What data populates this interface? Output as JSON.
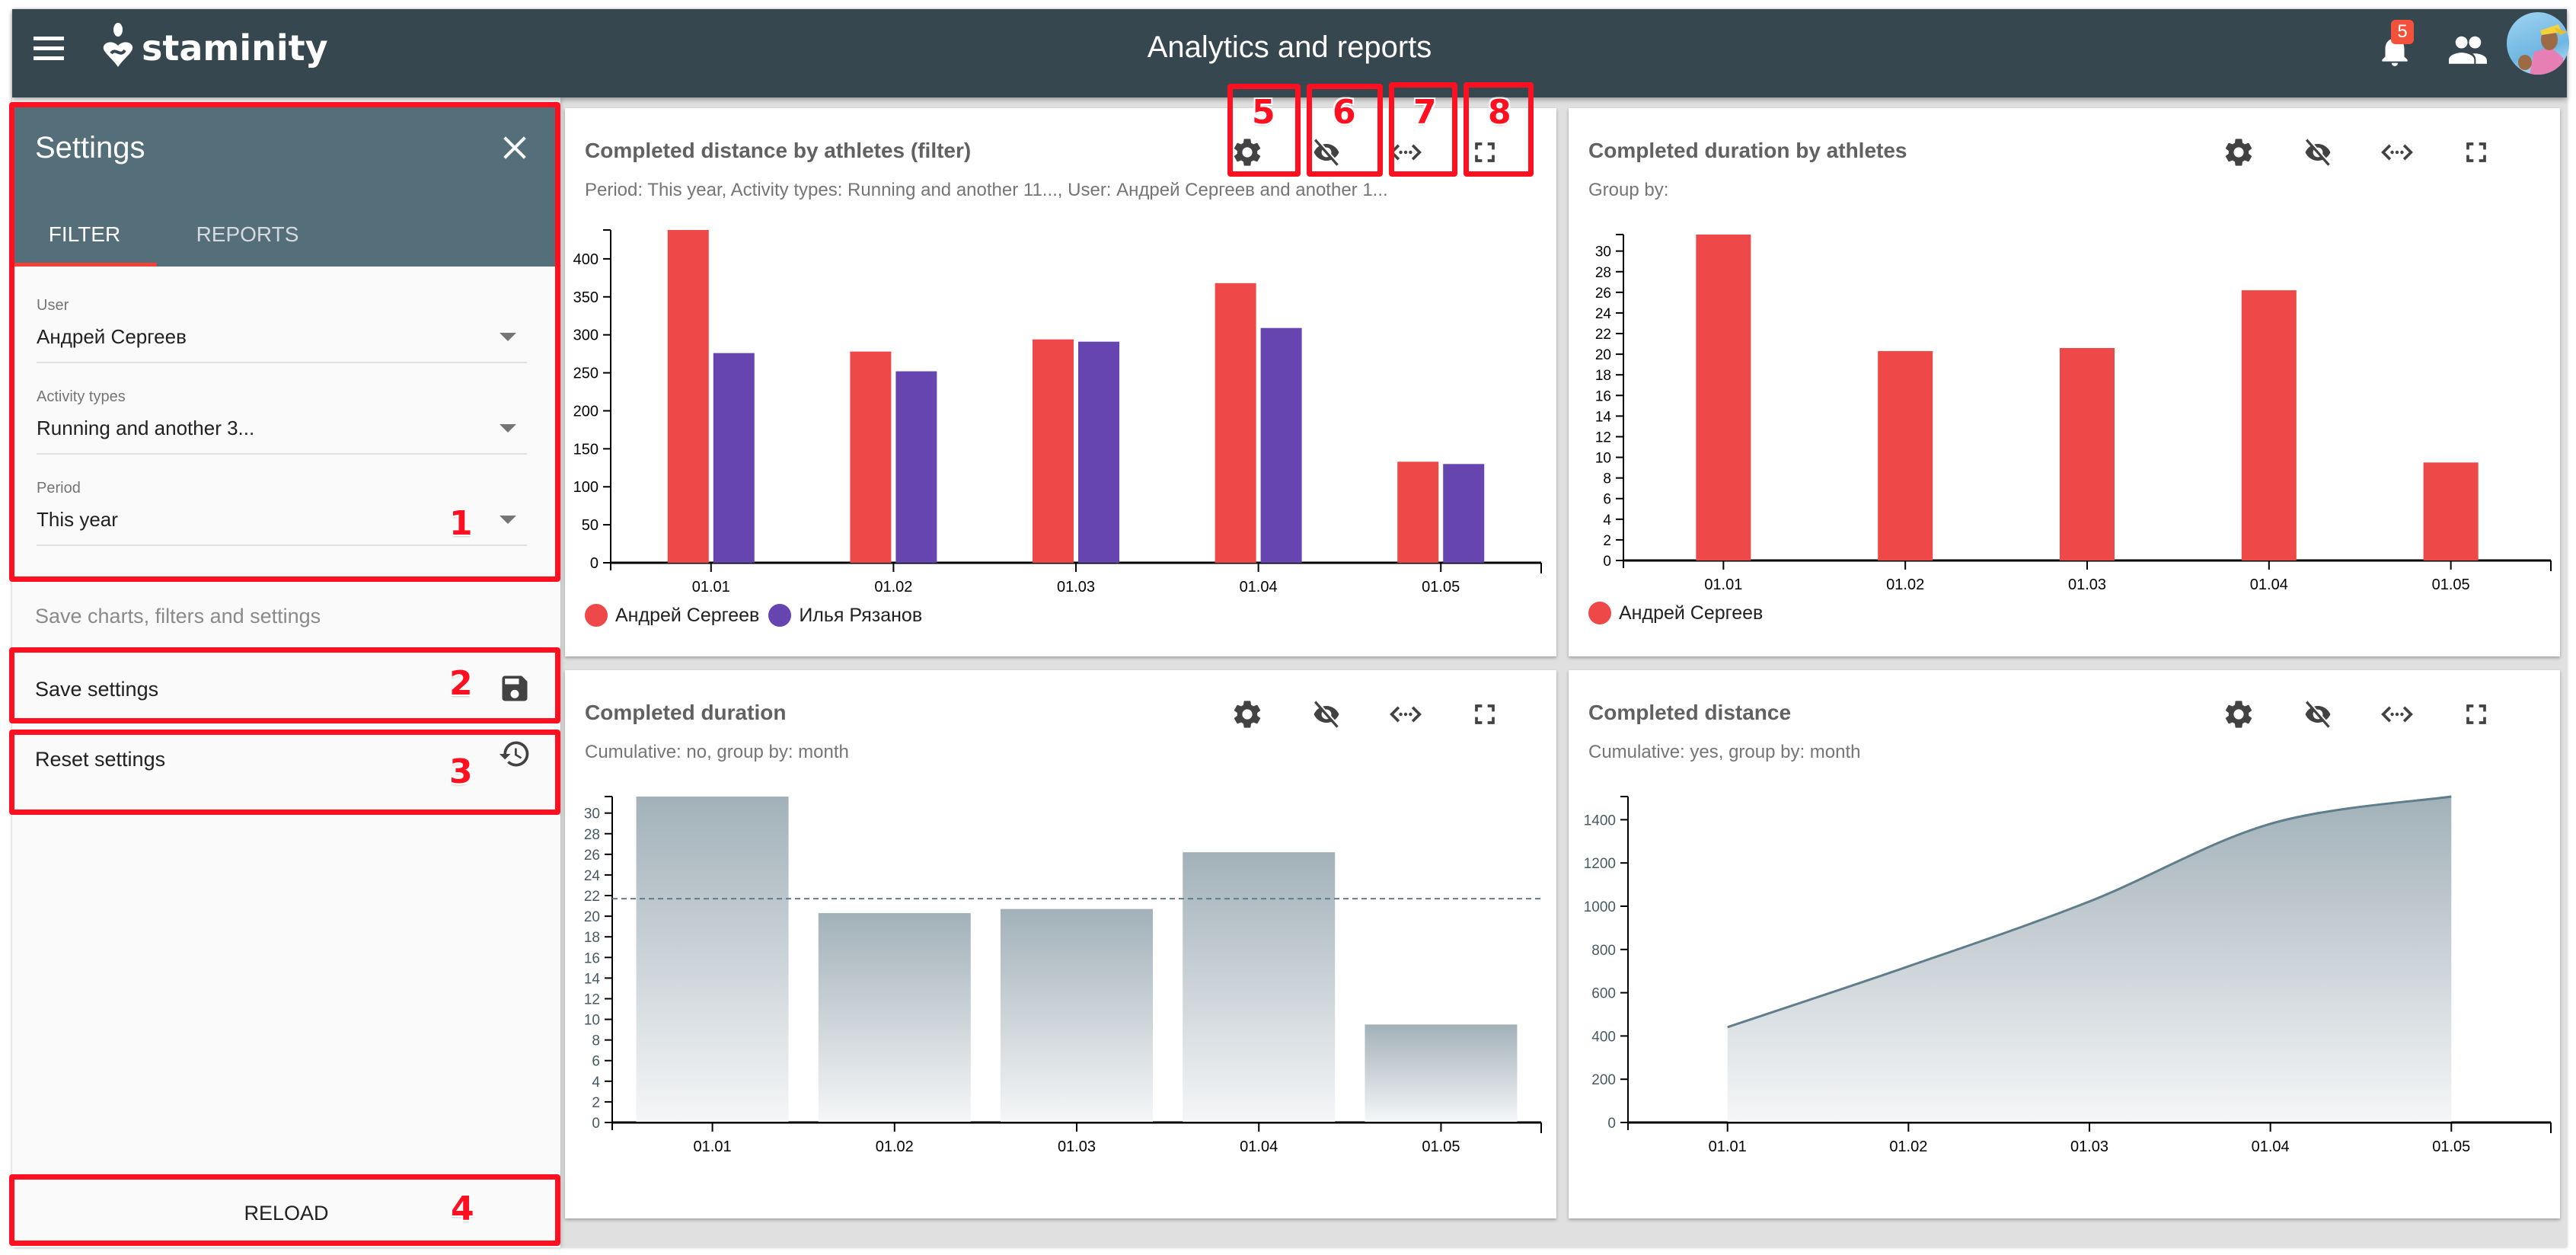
{
  "header": {
    "app_name": "staminity",
    "title": "Analytics and reports",
    "notification_count": "5",
    "icons": [
      "menu-icon",
      "staminity-logo",
      "bell-icon",
      "people-icon",
      "avatar"
    ]
  },
  "sidebar": {
    "title": "Settings",
    "tabs": [
      {
        "label": "FILTER",
        "active": true
      },
      {
        "label": "REPORTS",
        "active": false
      }
    ],
    "filters": [
      {
        "label": "User",
        "value": "Андрей Сергеев"
      },
      {
        "label": "Activity types",
        "value": "Running and another 3..."
      },
      {
        "label": "Period",
        "value": "This year"
      }
    ],
    "section_note": "Save charts, filters and settings",
    "save_label": "Save settings",
    "reset_label": "Reset settings",
    "reload_label": "RELOAD"
  },
  "annotations": [
    "1",
    "2",
    "3",
    "4",
    "5",
    "6",
    "7",
    "8"
  ],
  "colors": {
    "header": "#37474f",
    "panel_header": "#546e7a",
    "accent": "#f44336",
    "series_red": "#ef4848",
    "series_purple": "#6745b1",
    "area_line": "#607d8b"
  },
  "cards": [
    {
      "title": "Completed distance by athletes  (filter)",
      "subtitle": "Period: This year, Activity types: Running and another 11..., User: Андрей Сергеев and another 1..."
    },
    {
      "title": "Completed duration by athletes",
      "subtitle": "Group by:"
    },
    {
      "title": "Completed duration",
      "subtitle": "Cumulative: no, group by: month"
    },
    {
      "title": "Completed distance",
      "subtitle": "Cumulative: yes, group by: month"
    }
  ],
  "tool_icons": [
    "gear-icon",
    "eye-off-icon",
    "code-expand-icon",
    "fullscreen-icon"
  ],
  "chart_data": [
    {
      "type": "bar",
      "title": "Completed distance by athletes  (filter)",
      "categories": [
        "01.01",
        "01.02",
        "01.03",
        "01.04",
        "01.05"
      ],
      "series": [
        {
          "name": "Андрей Сергеев",
          "values": [
            438,
            278,
            294,
            368,
            133
          ]
        },
        {
          "name": "Илья Рязанов",
          "values": [
            276,
            252,
            291,
            309,
            130
          ]
        }
      ],
      "yticks": [
        0,
        50,
        100,
        150,
        200,
        250,
        300,
        350,
        400
      ],
      "ylim": [
        0,
        438
      ],
      "legend": "bottom-left",
      "grid": false
    },
    {
      "type": "bar",
      "title": "Completed duration by athletes",
      "categories": [
        "01.01",
        "01.02",
        "01.03",
        "01.04",
        "01.05"
      ],
      "series": [
        {
          "name": "Андрей Сергеев",
          "values": [
            31.6,
            20.3,
            20.6,
            26.2,
            9.5
          ]
        }
      ],
      "yticks": [
        0,
        2,
        4,
        6,
        8,
        10,
        12,
        14,
        16,
        18,
        20,
        22,
        24,
        26,
        28,
        30
      ],
      "ylim": [
        0,
        31.6
      ],
      "legend": "bottom-left",
      "grid": false
    },
    {
      "type": "bar",
      "title": "Completed duration",
      "categories": [
        "01.01",
        "01.02",
        "01.03",
        "01.04",
        "01.05"
      ],
      "series": [
        {
          "name": "Completed duration",
          "values": [
            31.6,
            20.3,
            20.7,
            26.2,
            9.5
          ]
        }
      ],
      "average_line": 21.7,
      "yticks": [
        0,
        2,
        4,
        6,
        8,
        10,
        12,
        14,
        16,
        18,
        20,
        22,
        24,
        26,
        28,
        30
      ],
      "ylim": [
        0,
        31.6
      ],
      "grid": false
    },
    {
      "type": "area",
      "title": "Completed distance",
      "categories": [
        "01.01",
        "01.02",
        "01.03",
        "01.04",
        "01.05"
      ],
      "series": [
        {
          "name": "Completed distance",
          "values": [
            441,
            722,
            1022,
            1381,
            1507
          ]
        }
      ],
      "yticks": [
        0,
        200,
        400,
        600,
        800,
        1000,
        1200,
        1400
      ],
      "ylim": [
        0,
        1507
      ],
      "grid": false
    }
  ]
}
